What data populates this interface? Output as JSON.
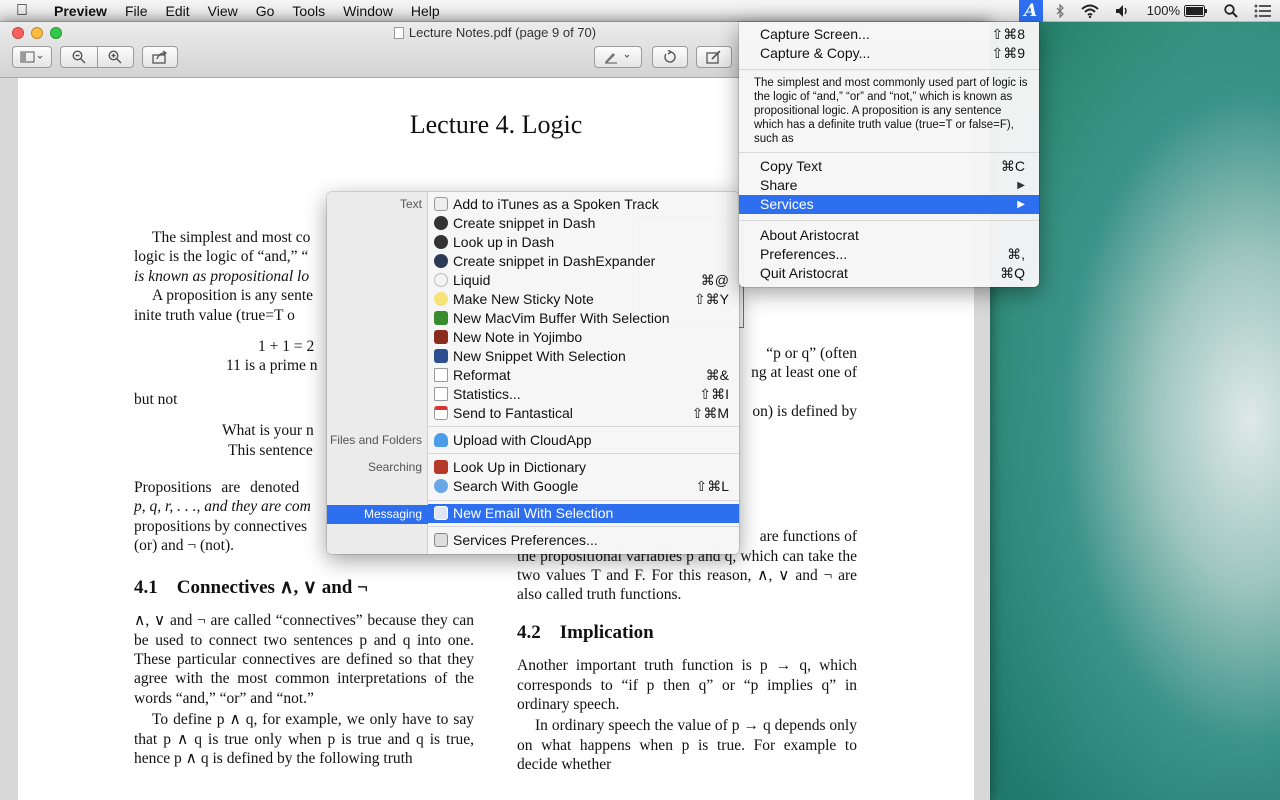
{
  "menubar": {
    "apple_icon": "apple-logo-icon",
    "app_name": "Preview",
    "items": [
      "File",
      "Edit",
      "View",
      "Go",
      "Tools",
      "Window",
      "Help"
    ],
    "battery": "100%",
    "status_icons": [
      "aristocrat-icon",
      "bluetooth-icon",
      "wifi-icon",
      "volume-icon",
      "battery-icon",
      "spotlight-icon",
      "notification-center-icon"
    ]
  },
  "window": {
    "title": "Lecture Notes.pdf (page 9 of 70)",
    "toolbar_icons": [
      "sidebar-view-icon",
      "zoom-out-icon",
      "zoom-in-icon",
      "share-icon",
      "markup-pen-icon",
      "rotate-icon",
      "edit-toolbar-icon"
    ]
  },
  "document": {
    "title": "Lecture 4. Logic",
    "left": {
      "p1": "The simplest and most co",
      "p1b": "logic is the logic of “and,” “",
      "p1c": "is known as propositional lo",
      "p2": "A proposition is any sente",
      "p2b": "inite truth value (true=T o",
      "eq1": "1 + 1 = 2",
      "eq2": "11 is a prime n",
      "butnot": "but not",
      "q1": "What is your n",
      "q2": "This sentence",
      "p3": "Propositions are denoted",
      "p3b": "p, q, r, . . ., and they are com",
      "p3c": "propositions by connectives",
      "p3d": "(or) and ¬ (not).",
      "sec41": "4.1 Connectives ∧, ∨ and ¬",
      "p4": "∧, ∨ and ¬ are called “connectives” because they can be used to connect two sentences p and q into one. These particular connectives are defined so that they agree with the most common interpretations of the words “and,” “or” and “not.”",
      "p5": "To define p ∧ q, for example, we only have to say that p ∧ q is true only when p is true and q is true, hence p ∧ q is defined by the following truth"
    },
    "right": {
      "r1": "“p or q” (often",
      "r2": "ng at least one of",
      "r3": "on) is defined by",
      "r4": "are functions of",
      "r5": "the propositional variables p and q, which can take the two values T and F. For this reason, ∧, ∨ and ¬ are also called truth functions.",
      "sec42": "4.2 Implication",
      "r6": "Another important truth function is p → q, which corresponds to “if p then q” or “p implies q” in ordinary speech.",
      "r7": "In ordinary speech the value of p → q depends only on what happens when p is true. For example to decide whether"
    }
  },
  "services_menu": {
    "categories": {
      "text": "Text",
      "files": "Files and Folders",
      "searching": "Searching",
      "messaging": "Messaging"
    },
    "items": [
      {
        "label": "Add to iTunes as a Spoken Track",
        "shortcut": "",
        "icon": "itunes-spoken-icon"
      },
      {
        "label": "Create snippet in Dash",
        "shortcut": "",
        "icon": "dash-icon"
      },
      {
        "label": "Look up in Dash",
        "shortcut": "",
        "icon": "dash-icon"
      },
      {
        "label": "Create snippet in DashExpander",
        "shortcut": "",
        "icon": "dashexpander-icon"
      },
      {
        "label": "Liquid",
        "shortcut": "⌘@",
        "icon": "liquid-icon"
      },
      {
        "label": "Make New Sticky Note",
        "shortcut": "⇧⌘Y",
        "icon": "sticky-note-icon"
      },
      {
        "label": "New MacVim Buffer With Selection",
        "shortcut": "",
        "icon": "macvim-icon"
      },
      {
        "label": "New Note in Yojimbo",
        "shortcut": "",
        "icon": "yojimbo-icon"
      },
      {
        "label": "New Snippet With Selection",
        "shortcut": "",
        "icon": "snippet-icon"
      },
      {
        "label": "Reformat",
        "shortcut": "⌘&",
        "icon": "document-icon"
      },
      {
        "label": "Statistics...",
        "shortcut": "⇧⌘I",
        "icon": "document-icon"
      },
      {
        "label": "Send to Fantastical",
        "shortcut": "⇧⌘M",
        "icon": "fantastical-icon"
      },
      {
        "label": "Upload with CloudApp",
        "shortcut": "",
        "icon": "cloudapp-icon"
      },
      {
        "label": "Look Up in Dictionary",
        "shortcut": "",
        "icon": "dictionary-icon"
      },
      {
        "label": "Search With Google",
        "shortcut": "⇧⌘L",
        "icon": "google-search-icon"
      },
      {
        "label": "New Email With Selection",
        "shortcut": "",
        "icon": "mail-icon"
      },
      {
        "label": "Services Preferences...",
        "shortcut": "",
        "icon": "preferences-icon"
      }
    ]
  },
  "aristocrat_menu": {
    "capture_screen": "Capture Screen...",
    "capture_screen_sc": "⇧⌘8",
    "capture_copy": "Capture & Copy...",
    "capture_copy_sc": "⇧⌘9",
    "preview_text": "The simplest and most commonly used part of logic is the logic of “and,” “or” and “not,” which is known as propositional logic. A proposition is any sentence which has a definite truth value (true=T or false=F), such as",
    "copy_text": "Copy Text",
    "copy_text_sc": "⌘C",
    "share": "Share",
    "services": "Services",
    "about": "About Aristocrat",
    "preferences": "Preferences...",
    "preferences_sc": "⌘,",
    "quit": "Quit Aristocrat",
    "quit_sc": "⌘Q",
    "submenu_arrow": "▶"
  }
}
